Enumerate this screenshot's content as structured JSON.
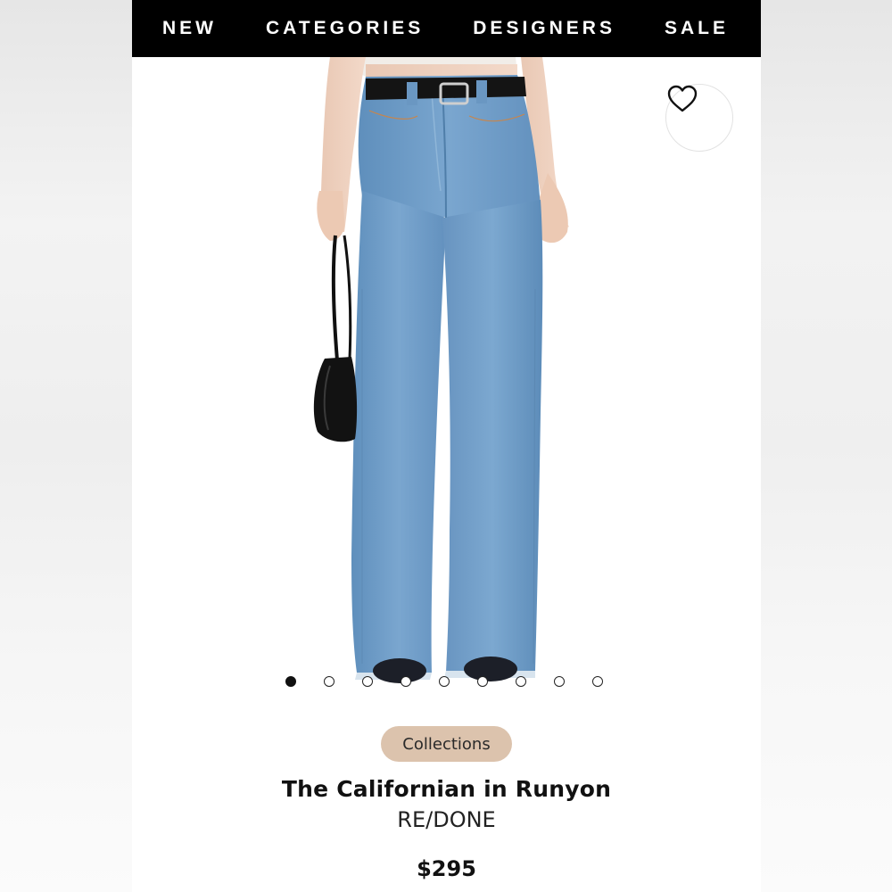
{
  "nav": {
    "items": [
      "NEW",
      "CATEGORIES",
      "DESIGNERS",
      "SALE"
    ]
  },
  "gallery": {
    "image_count": 9,
    "active_index": 0,
    "wishlist_icon": "heart-outline-icon"
  },
  "product": {
    "badge": "Collections",
    "title": "The Californian in Runyon",
    "brand": "RE/DONE",
    "price": "$295"
  },
  "colors": {
    "nav_bg": "#000000",
    "badge_bg": "#dcc3ad",
    "denim": "#6f9cc6"
  }
}
